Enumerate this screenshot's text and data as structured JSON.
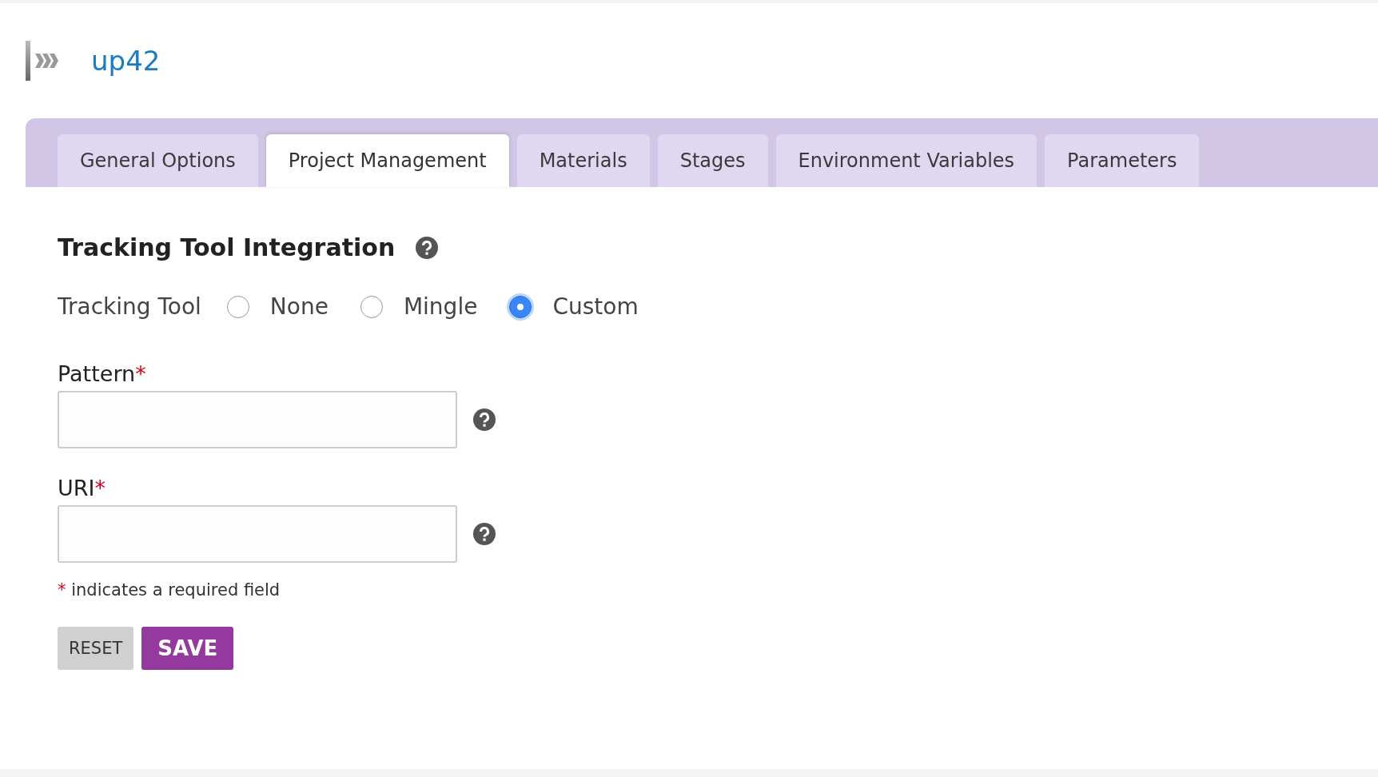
{
  "header": {
    "title": "up42"
  },
  "tabs": [
    {
      "label": "General Options",
      "selected": false
    },
    {
      "label": "Project Management",
      "selected": true
    },
    {
      "label": "Materials",
      "selected": false
    },
    {
      "label": "Stages",
      "selected": false
    },
    {
      "label": "Environment Variables",
      "selected": false
    },
    {
      "label": "Parameters",
      "selected": false
    }
  ],
  "section": {
    "title": "Tracking Tool Integration"
  },
  "tracking_tool": {
    "label": "Tracking Tool",
    "options": [
      {
        "label": "None",
        "selected": false
      },
      {
        "label": "Mingle",
        "selected": false
      },
      {
        "label": "Custom",
        "selected": true
      }
    ]
  },
  "fields": [
    {
      "label": "Pattern",
      "required_mark": "*"
    },
    {
      "label": "URI",
      "required_mark": "*"
    }
  ],
  "required_note": {
    "mark": "*",
    "text": "indicates a required field"
  },
  "buttons": [
    {
      "kind": "secondary",
      "label": "RESET"
    },
    {
      "kind": "primary",
      "label": "SAVE"
    }
  ]
}
